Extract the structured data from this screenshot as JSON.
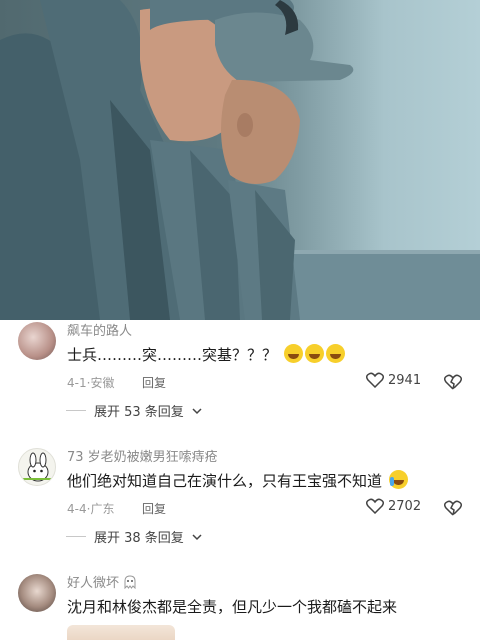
{
  "comments": [
    {
      "username": "飙车的路人",
      "text": "士兵………突………突基？？？",
      "emoji_count": 3,
      "date": "4-1",
      "location": "安徽",
      "reply_label": "回复",
      "likes": "2941",
      "expand_label": "展开 53 条回复"
    },
    {
      "username": "73 岁老奶被嫩男狂嗦痔疮",
      "text": "他们绝对知道自己在演什么，只有王宝强不知道",
      "emoji_count": 1,
      "date": "4-4",
      "location": "广东",
      "reply_label": "回复",
      "likes": "2702",
      "expand_label": "展开 38 条回复"
    },
    {
      "username": "好人微坏",
      "text": "沈月和林俊杰都是全责，但凡少一个我都磕不起来"
    }
  ],
  "colors": {
    "uniform": "#4f6a72",
    "sky": "#a8c4cb",
    "emoji": "#f7cf2b"
  }
}
